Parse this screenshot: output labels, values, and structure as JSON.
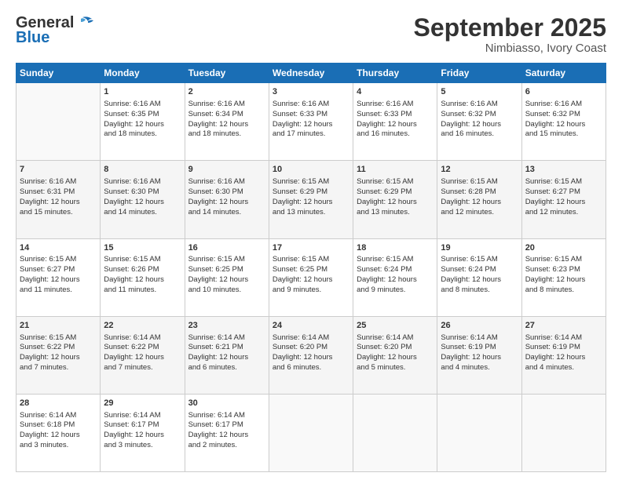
{
  "header": {
    "logo_general": "General",
    "logo_blue": "Blue",
    "month_title": "September 2025",
    "location": "Nimbiasso, Ivory Coast"
  },
  "calendar": {
    "days": [
      "Sunday",
      "Monday",
      "Tuesday",
      "Wednesday",
      "Thursday",
      "Friday",
      "Saturday"
    ],
    "weeks": [
      {
        "cells": [
          {
            "day": "",
            "content": ""
          },
          {
            "day": "1",
            "content": "Sunrise: 6:16 AM\nSunset: 6:35 PM\nDaylight: 12 hours\nand 18 minutes."
          },
          {
            "day": "2",
            "content": "Sunrise: 6:16 AM\nSunset: 6:34 PM\nDaylight: 12 hours\nand 18 minutes."
          },
          {
            "day": "3",
            "content": "Sunrise: 6:16 AM\nSunset: 6:33 PM\nDaylight: 12 hours\nand 17 minutes."
          },
          {
            "day": "4",
            "content": "Sunrise: 6:16 AM\nSunset: 6:33 PM\nDaylight: 12 hours\nand 16 minutes."
          },
          {
            "day": "5",
            "content": "Sunrise: 6:16 AM\nSunset: 6:32 PM\nDaylight: 12 hours\nand 16 minutes."
          },
          {
            "day": "6",
            "content": "Sunrise: 6:16 AM\nSunset: 6:32 PM\nDaylight: 12 hours\nand 15 minutes."
          }
        ]
      },
      {
        "cells": [
          {
            "day": "7",
            "content": "Sunrise: 6:16 AM\nSunset: 6:31 PM\nDaylight: 12 hours\nand 15 minutes."
          },
          {
            "day": "8",
            "content": "Sunrise: 6:16 AM\nSunset: 6:30 PM\nDaylight: 12 hours\nand 14 minutes."
          },
          {
            "day": "9",
            "content": "Sunrise: 6:16 AM\nSunset: 6:30 PM\nDaylight: 12 hours\nand 14 minutes."
          },
          {
            "day": "10",
            "content": "Sunrise: 6:15 AM\nSunset: 6:29 PM\nDaylight: 12 hours\nand 13 minutes."
          },
          {
            "day": "11",
            "content": "Sunrise: 6:15 AM\nSunset: 6:29 PM\nDaylight: 12 hours\nand 13 minutes."
          },
          {
            "day": "12",
            "content": "Sunrise: 6:15 AM\nSunset: 6:28 PM\nDaylight: 12 hours\nand 12 minutes."
          },
          {
            "day": "13",
            "content": "Sunrise: 6:15 AM\nSunset: 6:27 PM\nDaylight: 12 hours\nand 12 minutes."
          }
        ]
      },
      {
        "cells": [
          {
            "day": "14",
            "content": "Sunrise: 6:15 AM\nSunset: 6:27 PM\nDaylight: 12 hours\nand 11 minutes."
          },
          {
            "day": "15",
            "content": "Sunrise: 6:15 AM\nSunset: 6:26 PM\nDaylight: 12 hours\nand 11 minutes."
          },
          {
            "day": "16",
            "content": "Sunrise: 6:15 AM\nSunset: 6:25 PM\nDaylight: 12 hours\nand 10 minutes."
          },
          {
            "day": "17",
            "content": "Sunrise: 6:15 AM\nSunset: 6:25 PM\nDaylight: 12 hours\nand 9 minutes."
          },
          {
            "day": "18",
            "content": "Sunrise: 6:15 AM\nSunset: 6:24 PM\nDaylight: 12 hours\nand 9 minutes."
          },
          {
            "day": "19",
            "content": "Sunrise: 6:15 AM\nSunset: 6:24 PM\nDaylight: 12 hours\nand 8 minutes."
          },
          {
            "day": "20",
            "content": "Sunrise: 6:15 AM\nSunset: 6:23 PM\nDaylight: 12 hours\nand 8 minutes."
          }
        ]
      },
      {
        "cells": [
          {
            "day": "21",
            "content": "Sunrise: 6:15 AM\nSunset: 6:22 PM\nDaylight: 12 hours\nand 7 minutes."
          },
          {
            "day": "22",
            "content": "Sunrise: 6:14 AM\nSunset: 6:22 PM\nDaylight: 12 hours\nand 7 minutes."
          },
          {
            "day": "23",
            "content": "Sunrise: 6:14 AM\nSunset: 6:21 PM\nDaylight: 12 hours\nand 6 minutes."
          },
          {
            "day": "24",
            "content": "Sunrise: 6:14 AM\nSunset: 6:20 PM\nDaylight: 12 hours\nand 6 minutes."
          },
          {
            "day": "25",
            "content": "Sunrise: 6:14 AM\nSunset: 6:20 PM\nDaylight: 12 hours\nand 5 minutes."
          },
          {
            "day": "26",
            "content": "Sunrise: 6:14 AM\nSunset: 6:19 PM\nDaylight: 12 hours\nand 4 minutes."
          },
          {
            "day": "27",
            "content": "Sunrise: 6:14 AM\nSunset: 6:19 PM\nDaylight: 12 hours\nand 4 minutes."
          }
        ]
      },
      {
        "cells": [
          {
            "day": "28",
            "content": "Sunrise: 6:14 AM\nSunset: 6:18 PM\nDaylight: 12 hours\nand 3 minutes."
          },
          {
            "day": "29",
            "content": "Sunrise: 6:14 AM\nSunset: 6:17 PM\nDaylight: 12 hours\nand 3 minutes."
          },
          {
            "day": "30",
            "content": "Sunrise: 6:14 AM\nSunset: 6:17 PM\nDaylight: 12 hours\nand 2 minutes."
          },
          {
            "day": "",
            "content": ""
          },
          {
            "day": "",
            "content": ""
          },
          {
            "day": "",
            "content": ""
          },
          {
            "day": "",
            "content": ""
          }
        ]
      }
    ]
  }
}
